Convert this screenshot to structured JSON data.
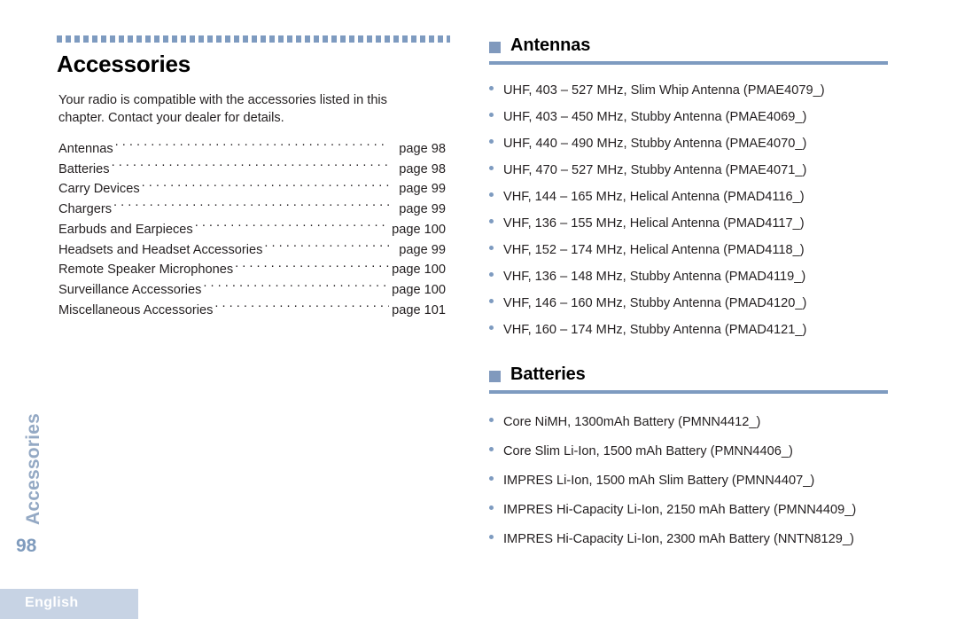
{
  "sidebar": {
    "chapter_label": "Accessories",
    "page_number": "98",
    "language": "English"
  },
  "left_column": {
    "title": "Accessories",
    "intro": "Your radio is compatible with the accessories listed in this chapter. Contact your dealer for details.",
    "toc": [
      {
        "label": "Antennas",
        "page": "page 98"
      },
      {
        "label": "Batteries",
        "page": "page 98"
      },
      {
        "label": "Carry Devices",
        "page": "page 99"
      },
      {
        "label": "Chargers",
        "page": "page 99"
      },
      {
        "label": "Earbuds and Earpieces",
        "page": "page 100"
      },
      {
        "label": "Headsets and Headset Accessories",
        "page": "page 99"
      },
      {
        "label": "Remote Speaker Microphones",
        "page": "page 100"
      },
      {
        "label": "Surveillance Accessories",
        "page": "page 100"
      },
      {
        "label": "Miscellaneous Accessories",
        "page": "page 101"
      }
    ]
  },
  "right_column": {
    "antennas": {
      "title": "Antennas",
      "items": [
        "UHF, 403 – 527 MHz, Slim Whip Antenna (PMAE4079_)",
        "UHF, 403 – 450 MHz, Stubby Antenna (PMAE4069_)",
        "UHF, 440 – 490 MHz, Stubby Antenna (PMAE4070_)",
        "UHF, 470 – 527 MHz, Stubby Antenna (PMAE4071_)",
        "VHF, 144 – 165 MHz, Helical Antenna (PMAD4116_)",
        "VHF, 136 – 155 MHz, Helical Antenna (PMAD4117_)",
        "VHF, 152 – 174 MHz, Helical Antenna (PMAD4118_)",
        "VHF, 136 – 148 MHz, Stubby Antenna (PMAD4119_)",
        "VHF, 146 – 160 MHz, Stubby Antenna (PMAD4120_)",
        "VHF, 160 – 174 MHz, Stubby Antenna (PMAD4121_)"
      ]
    },
    "batteries": {
      "title": "Batteries",
      "items": [
        "Core NiMH, 1300mAh Battery (PMNN4412_)",
        "Core Slim Li-Ion, 1500 mAh Battery (PMNN4406_)",
        "IMPRES Li-Ion, 1500 mAh Slim Battery (PMNN4407_)",
        "IMPRES Hi-Capacity Li-Ion, 2150 mAh Battery (PMNN4409_)",
        "IMPRES Hi-Capacity Li-Ion, 2300 mAh Battery (NNTN8129_)"
      ]
    }
  },
  "colors": {
    "accent_blue": "#7e9bc0",
    "marker_blue": "#8099bd",
    "sidebar_text": "#94a9c4",
    "language_bar": "#c7d3e4"
  }
}
